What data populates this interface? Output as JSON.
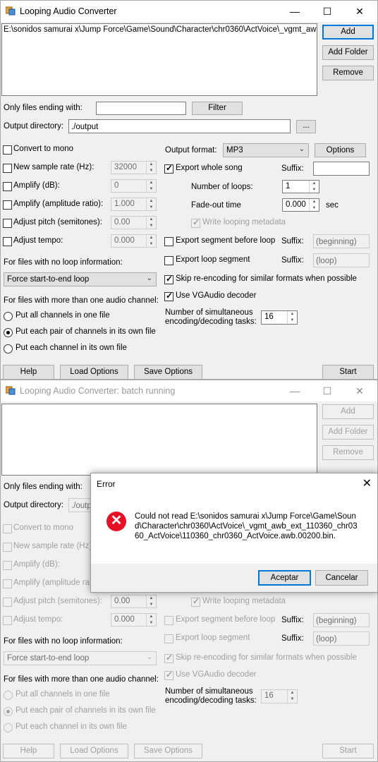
{
  "win1": {
    "title": "Looping Audio Converter",
    "file_list": [
      "E:\\sonidos samurai x\\Jump Force\\Game\\Sound\\Character\\chr0360\\ActVoice\\_vgmt_awb_e"
    ],
    "add_label": "Add",
    "add_folder_label": "Add Folder",
    "remove_label": "Remove",
    "filter_label": "Only files ending with:",
    "filter_value": "",
    "filter_button": "Filter",
    "output_dir_label": "Output directory:",
    "output_dir_value": "./output",
    "browse_label": "...",
    "convert_mono": "Convert to mono",
    "new_sample_rate": "New sample rate (Hz):",
    "sample_rate_value": "32000",
    "amplify_db": "Amplify (dB):",
    "amplify_db_value": "0",
    "amplify_ratio": "Amplify (amplitude ratio):",
    "amplify_ratio_value": "1.000",
    "adjust_pitch": "Adjust pitch (semitones):",
    "pitch_value": "0.00",
    "adjust_tempo": "Adjust tempo:",
    "tempo_value": "0.000",
    "no_loop_label": "For files with no loop information:",
    "no_loop_value": "Force start-to-end loop",
    "channels_label": "For files with more than one audio channel:",
    "radio_all": "Put all channels in one file",
    "radio_pair": "Put each pair of channels in its own file",
    "radio_each": "Put each channel in its own file",
    "output_format_label": "Output format:",
    "output_format_value": "MP3",
    "options_label": "Options",
    "export_whole": "Export whole song",
    "suffix_label": "Suffix:",
    "suffix_whole_value": "",
    "num_loops_label": "Number of loops:",
    "num_loops_value": "1",
    "fadeout_label": "Fade-out time",
    "fadeout_value": "0.000",
    "sec_label": "sec",
    "write_meta": "Write looping metadata",
    "export_before": "Export segment before loop",
    "suffix_before_value": "(beginning)",
    "export_loop": "Export loop segment",
    "suffix_loop_value": "(loop)",
    "skip_reencode": "Skip re-encoding for similar formats when possible",
    "use_vgaudio": "Use VGAudio decoder",
    "num_tasks_label": "Number of simultaneous encoding/decoding tasks:",
    "num_tasks_value": "16",
    "help_label": "Help",
    "load_label": "Load Options",
    "save_label": "Save Options",
    "start_label": "Start"
  },
  "win2": {
    "title": "Looping Audio Converter: batch running",
    "output_dir_value": "./outp"
  },
  "dialog": {
    "title": "Error",
    "message": "Could not read E:\\sonidos samurai x\\Jump Force\\Game\\Sound\\Character\\chr0360\\ActVoice\\_vgmt_awb_ext_110360_chr0360_ActVoice\\110360_chr0360_ActVoice.awb.00200.bin.",
    "accept_label": "Aceptar",
    "cancel_label": "Cancelar"
  },
  "colors": {
    "error_red": "#e81123",
    "accent": "#0078d7"
  }
}
